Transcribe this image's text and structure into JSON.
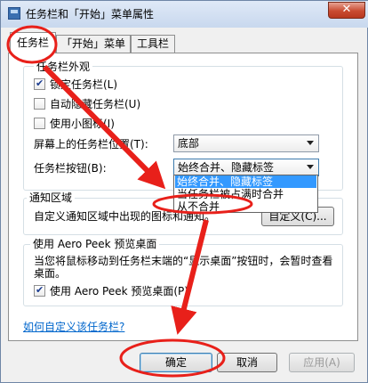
{
  "window": {
    "title": "任务栏和「开始」菜单属性",
    "close_glyph": "✕"
  },
  "tabs": [
    {
      "label": "任务栏",
      "active": true
    },
    {
      "label": "「开始」菜单",
      "active": false
    },
    {
      "label": "工具栏",
      "active": false
    }
  ],
  "taskbar_appearance": {
    "title": "任务栏外观",
    "lock_taskbar": {
      "label": "锁定任务栏(L)",
      "checked": true
    },
    "auto_hide": {
      "label": "自动隐藏任务栏(U)",
      "checked": false
    },
    "small_icons": {
      "label": "使用小图标(I)",
      "checked": false
    },
    "location_label": "屏幕上的任务栏位置(T):",
    "location_value": "底部",
    "buttons_label": "任务栏按钮(B):",
    "buttons_value": "始终合并、隐藏标签",
    "buttons_options": [
      "始终合并、隐藏标签",
      "当任务栏被占满时合并",
      "从不合并"
    ],
    "buttons_selected_index": 0
  },
  "notification_area": {
    "title": "通知区域",
    "description": "自定义通知区域中出现的图标和通知。",
    "customize_label": "自定义(C)..."
  },
  "aero_peek": {
    "title": "使用 Aero Peek 预览桌面",
    "description": "当您将鼠标移动到任务栏末端的“显示桌面”按钮时，会暂时查看桌面。",
    "checkbox": {
      "label": "使用 Aero Peek 预览桌面(P)",
      "checked": true
    }
  },
  "help_link": "如何自定义该任务栏?",
  "footer": {
    "ok_label": "确定",
    "cancel_label": "取消",
    "apply_label": "应用(A)"
  },
  "annotation": {
    "color": "#e8201a"
  }
}
